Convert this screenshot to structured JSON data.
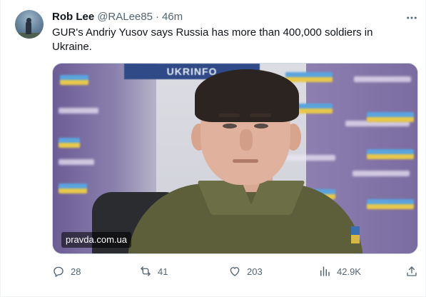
{
  "tweet": {
    "display_name": "Rob Lee",
    "handle": "@RALee85",
    "separator": "·",
    "time": "46m",
    "text": "GUR's Andriy Yusov says Russia has more than 400,000 soldiers in Ukraine.",
    "media": {
      "banner_text": "UKRINFO",
      "watermark": "pravda.com.ua"
    },
    "actions": {
      "replies": "28",
      "retweets": "41",
      "likes": "203",
      "views": "42.9K"
    }
  },
  "icons": {
    "more": "more-icon",
    "reply": "reply-icon",
    "retweet": "retweet-icon",
    "like": "like-icon",
    "views": "views-icon",
    "share": "share-icon"
  },
  "colors": {
    "text_primary": "#0f1419",
    "text_secondary": "#536471",
    "border": "#cfd9de"
  }
}
